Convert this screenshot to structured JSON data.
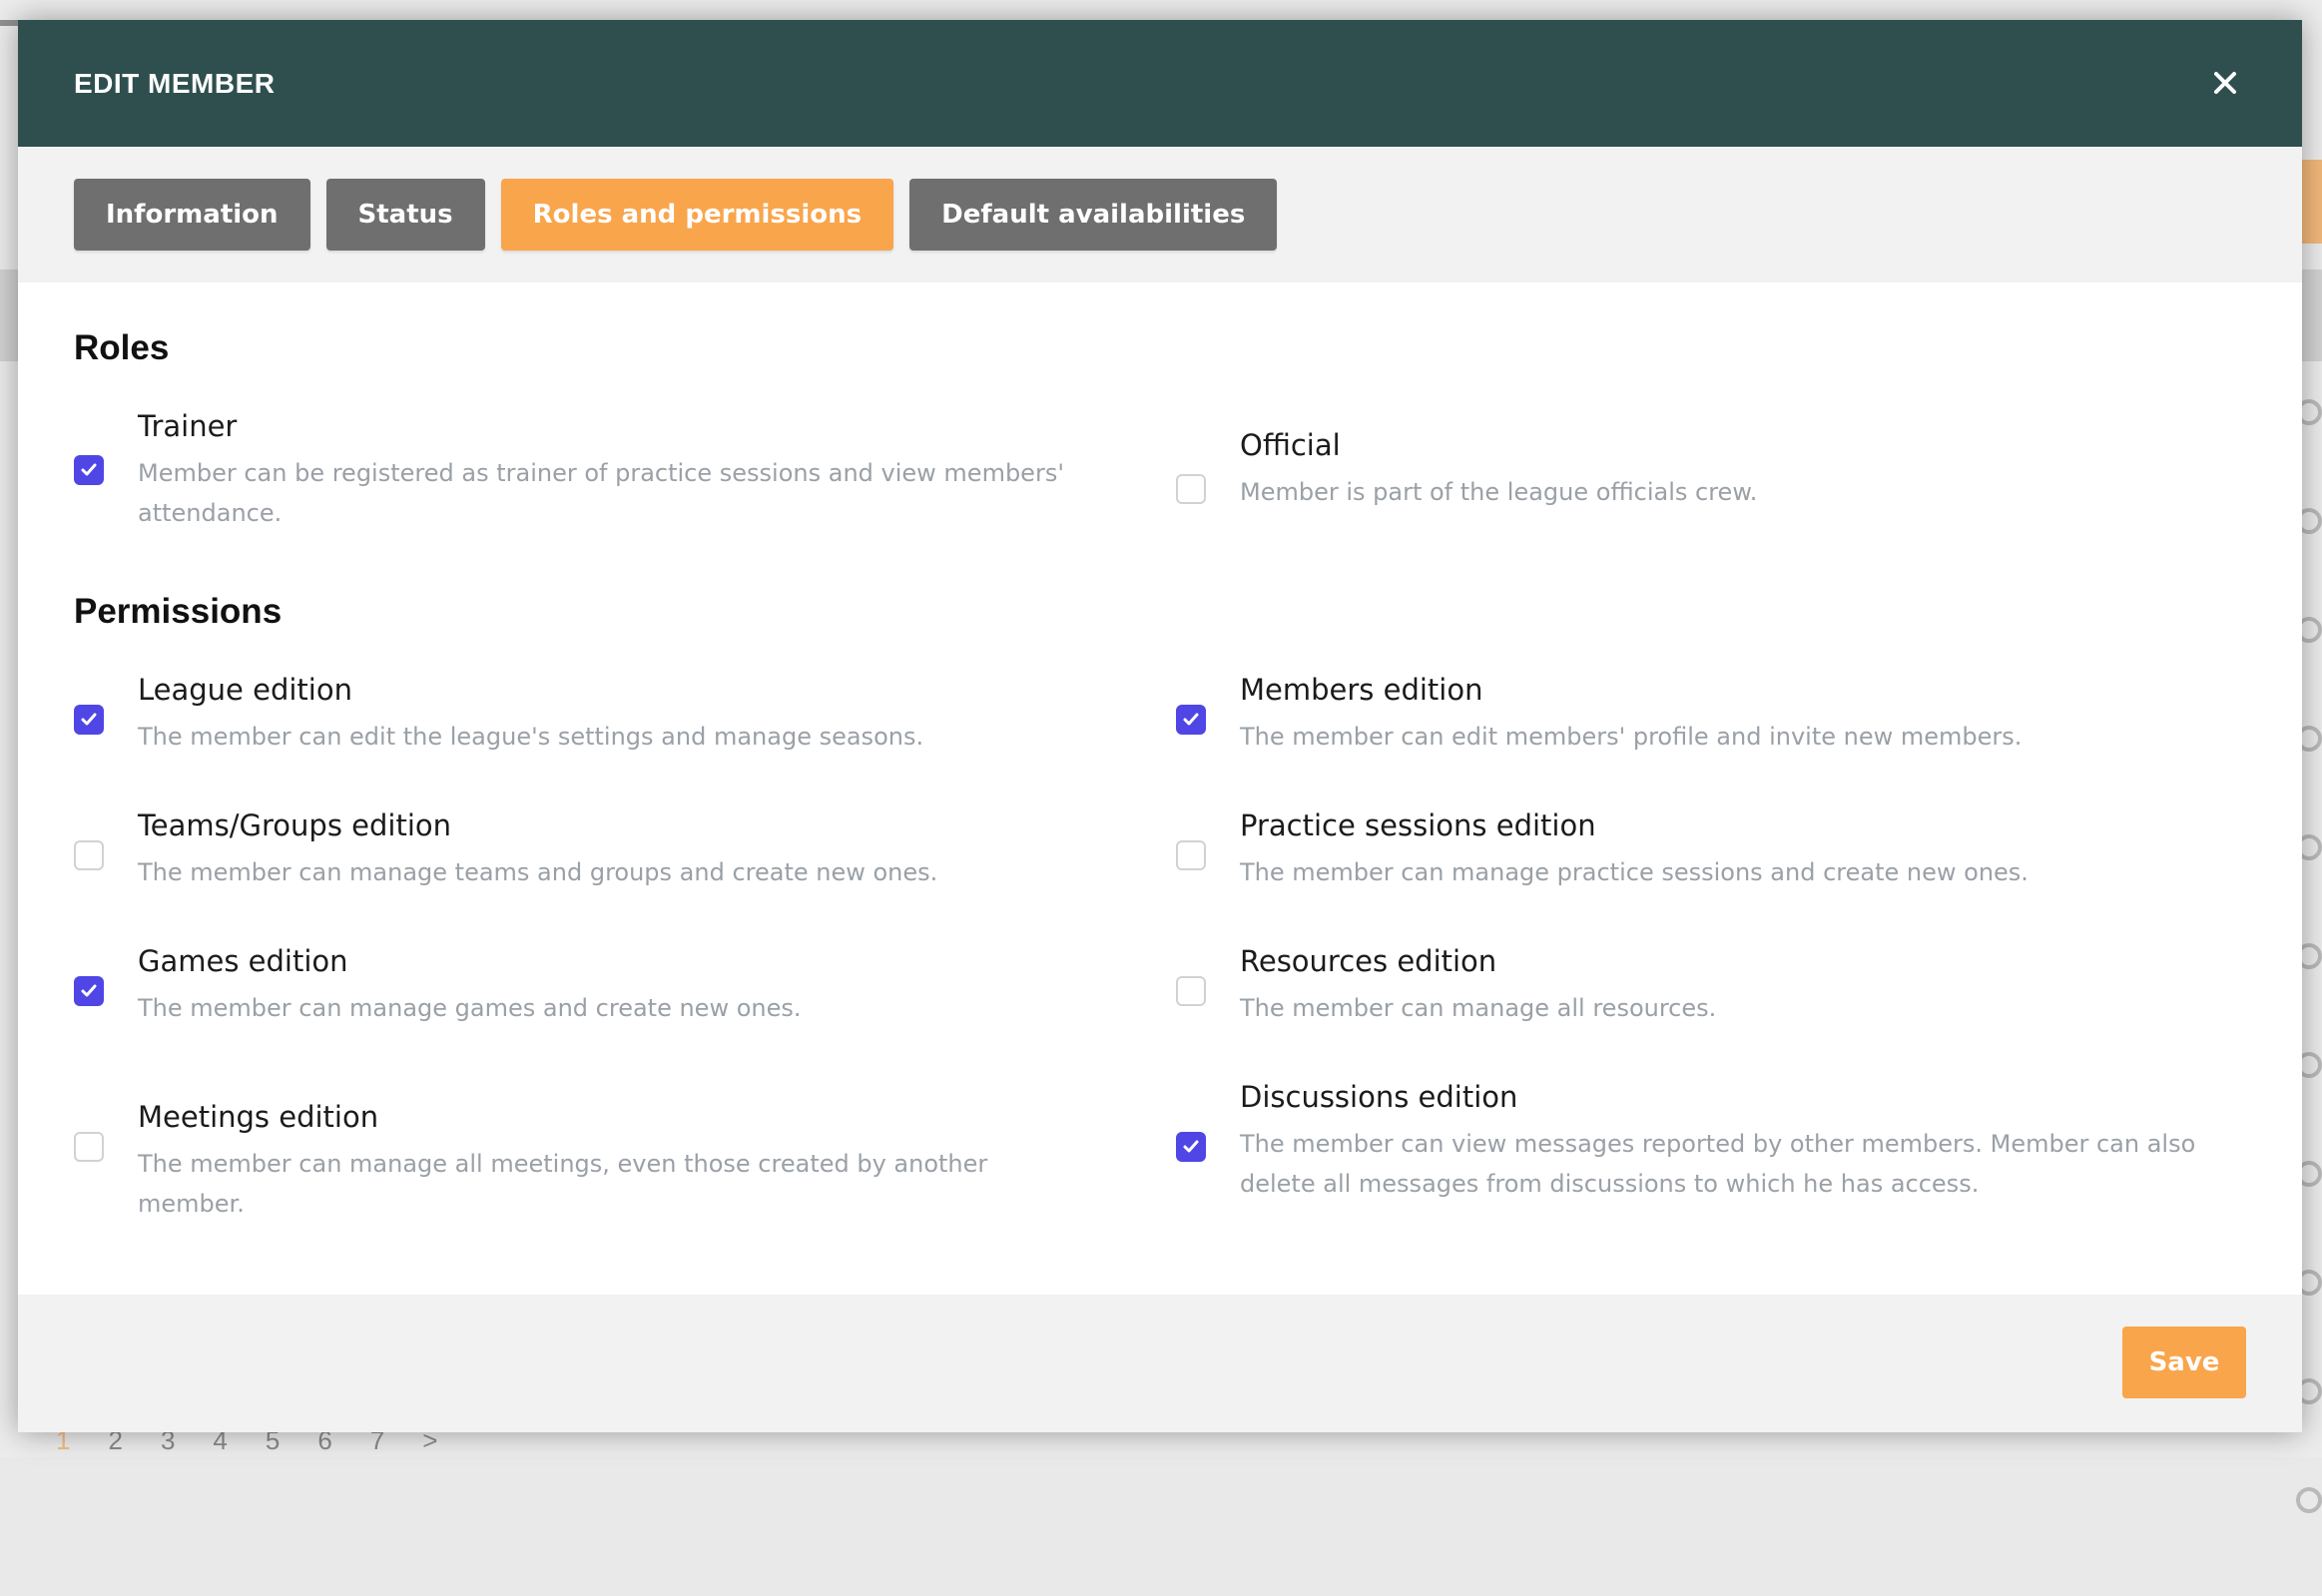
{
  "background": {
    "pager": [
      "1",
      "2",
      "3",
      "4",
      "5",
      "6",
      "7",
      ">"
    ]
  },
  "modal": {
    "title": "EDIT MEMBER",
    "close_icon": "close-icon"
  },
  "tabs": [
    {
      "label": "Information",
      "active": false
    },
    {
      "label": "Status",
      "active": false
    },
    {
      "label": "Roles and permissions",
      "active": true
    },
    {
      "label": "Default availabilities",
      "active": false
    }
  ],
  "roles": {
    "title": "Roles",
    "items": [
      {
        "label": "Trainer",
        "description": "Member can be registered as trainer of practice sessions and view members' attendance.",
        "checked": true
      },
      {
        "label": "Official",
        "description": "Member is part of the league officials crew.",
        "checked": false
      }
    ]
  },
  "permissions": {
    "title": "Permissions",
    "items": [
      {
        "label": "League edition",
        "description": "The member can edit the league's settings and manage seasons.",
        "checked": true
      },
      {
        "label": "Members edition",
        "description": "The member can edit members' profile and invite new members.",
        "checked": true
      },
      {
        "label": "Teams/Groups edition",
        "description": "The member can manage teams and groups and create new ones.",
        "checked": false
      },
      {
        "label": "Practice sessions edition",
        "description": "The member can manage practice sessions and create new ones.",
        "checked": false
      },
      {
        "label": "Games edition",
        "description": "The member can manage games and create new ones.",
        "checked": true
      },
      {
        "label": "Resources edition",
        "description": "The member can manage all resources.",
        "checked": false
      },
      {
        "label": "Meetings edition",
        "description": "The member can manage all meetings, even those created by another member.",
        "checked": false
      },
      {
        "label": "Discussions edition",
        "description": "The member can view messages reported by other members. Member can also delete all messages from discussions to which he has access.",
        "checked": true
      }
    ]
  },
  "footer": {
    "save_label": "Save"
  },
  "colors": {
    "header": "#2f4f4f",
    "accent": "#f9a54c",
    "checkbox": "#4f46e5",
    "tab_inactive": "#6f6f6f"
  }
}
